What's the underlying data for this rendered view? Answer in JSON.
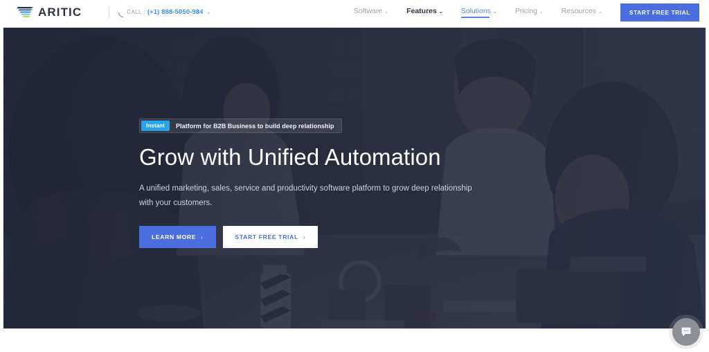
{
  "brand": {
    "name": "ARITIC",
    "logo_icon": "wing-swoosh-icon",
    "colors": {
      "navy": "#2b3443",
      "blue": "#3d8ef0",
      "green": "#b9d94a"
    }
  },
  "topbar": {
    "call": {
      "icon": "phone-icon",
      "label": "CALL :",
      "number": "(+1) 888-5050-984",
      "caret": "⌄"
    },
    "nav": [
      {
        "label": "Software",
        "caret": "⌄",
        "state": "default"
      },
      {
        "label": "Features",
        "caret": "⌄",
        "state": "hover"
      },
      {
        "label": "Solutions",
        "caret": "⌄",
        "state": "active"
      },
      {
        "label": "Pricing",
        "caret": "⌄",
        "state": "default"
      },
      {
        "label": "Resources",
        "caret": "⌄",
        "state": "default"
      }
    ],
    "cta": {
      "label": "START FREE TRIAL",
      "color": "#4a6ee0"
    }
  },
  "hero": {
    "badge": {
      "pill": "Instant",
      "pill_color": "#2aa4e8",
      "text": "Platform for B2B Business to build deep relationship"
    },
    "title": "Grow with Unified Automation",
    "subtitle": "A unified marketing, sales, service and productivity software platform to grow deep relationship with your customers.",
    "buttons": [
      {
        "label": "LEARN MORE",
        "chevron": "›",
        "style": "primary"
      },
      {
        "label": "START FREE TRIAL",
        "chevron": "›",
        "style": "light"
      }
    ],
    "background": {
      "scene": "team working at desk with brick wall",
      "overlay_color": "#242a3c"
    }
  },
  "chat": {
    "icon": "chat-bubble-icon",
    "color": "#8d8f96"
  }
}
